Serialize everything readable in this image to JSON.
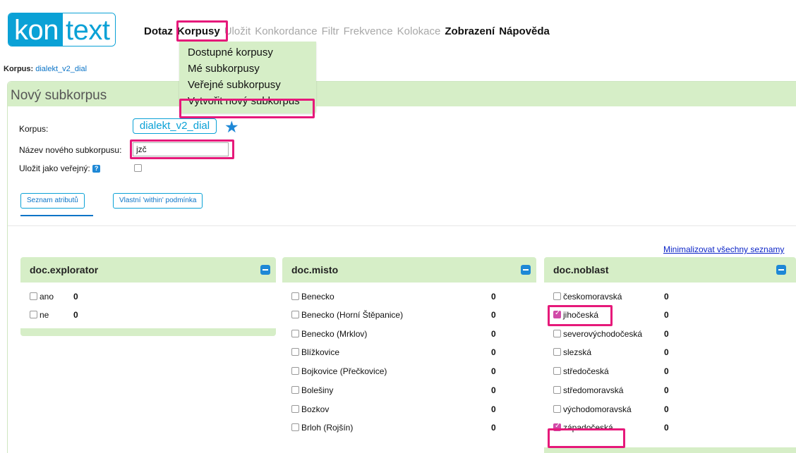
{
  "logo": {
    "part1": "kon",
    "part2": "text"
  },
  "menu": {
    "items": [
      {
        "label": "Dotaz",
        "state": "active"
      },
      {
        "label": "Korpusy",
        "state": "active"
      },
      {
        "label": "Uložit",
        "state": "disabled"
      },
      {
        "label": "Konkordance",
        "state": "disabled"
      },
      {
        "label": "Filtr",
        "state": "disabled"
      },
      {
        "label": "Frekvence",
        "state": "disabled"
      },
      {
        "label": "Kolokace",
        "state": "disabled"
      },
      {
        "label": "Zobrazení",
        "state": "active"
      },
      {
        "label": "Nápověda",
        "state": "active"
      }
    ],
    "dropdown": [
      "Dostupné korpusy",
      "Mé subkorpusy",
      "Veřejné subkorpusy",
      "Vytvořit nový subkorpus"
    ]
  },
  "corpus_line": {
    "label": "Korpus:",
    "value": "dialekt_v2_dial"
  },
  "panel": {
    "title": "Nový subkorpus"
  },
  "form": {
    "corpus_label": "Korpus:",
    "corpus_value": "dialekt_v2_dial",
    "name_label": "Název nového subkorpusu:",
    "name_value": "jzč",
    "public_label": "Uložit jako veřejný:",
    "help_glyph": "?"
  },
  "tabs": {
    "attrs": "Seznam atributů",
    "within": "Vlastní 'within' podmínka"
  },
  "minimize_all": "Minimalizovat všechny seznamy",
  "boxes": {
    "explorator": {
      "title": "doc.explorator",
      "items": [
        {
          "label": "ano",
          "count": "0",
          "checked": false
        },
        {
          "label": "ne",
          "count": "0",
          "checked": false
        }
      ]
    },
    "misto": {
      "title": "doc.misto",
      "items": [
        {
          "label": "Benecko",
          "count": "0",
          "checked": false
        },
        {
          "label": "Benecko (Horní Štěpanice)",
          "count": "0",
          "checked": false
        },
        {
          "label": "Benecko (Mrklov)",
          "count": "0",
          "checked": false
        },
        {
          "label": "Blížkovice",
          "count": "0",
          "checked": false
        },
        {
          "label": "Bojkovice (Přečkovice)",
          "count": "0",
          "checked": false
        },
        {
          "label": "Bolešiny",
          "count": "0",
          "checked": false
        },
        {
          "label": "Bozkov",
          "count": "0",
          "checked": false
        },
        {
          "label": "Brloh (Rojšín)",
          "count": "0",
          "checked": false
        }
      ]
    },
    "noblast": {
      "title": "doc.noblast",
      "items": [
        {
          "label": "českomoravská",
          "count": "0",
          "checked": false
        },
        {
          "label": "jihočeská",
          "count": "0",
          "checked": true
        },
        {
          "label": "severovýchodočeská",
          "count": "0",
          "checked": false
        },
        {
          "label": "slezská",
          "count": "0",
          "checked": false
        },
        {
          "label": "středočeská",
          "count": "0",
          "checked": false
        },
        {
          "label": "středomoravská",
          "count": "0",
          "checked": false
        },
        {
          "label": "východomoravská",
          "count": "0",
          "checked": false
        },
        {
          "label": "západočeská",
          "count": "0",
          "checked": true
        }
      ]
    }
  },
  "colors": {
    "accent": "#0aa1d6",
    "panel": "#d6eec7",
    "highlight": "#e6197a",
    "checked": "#d14aa8"
  }
}
